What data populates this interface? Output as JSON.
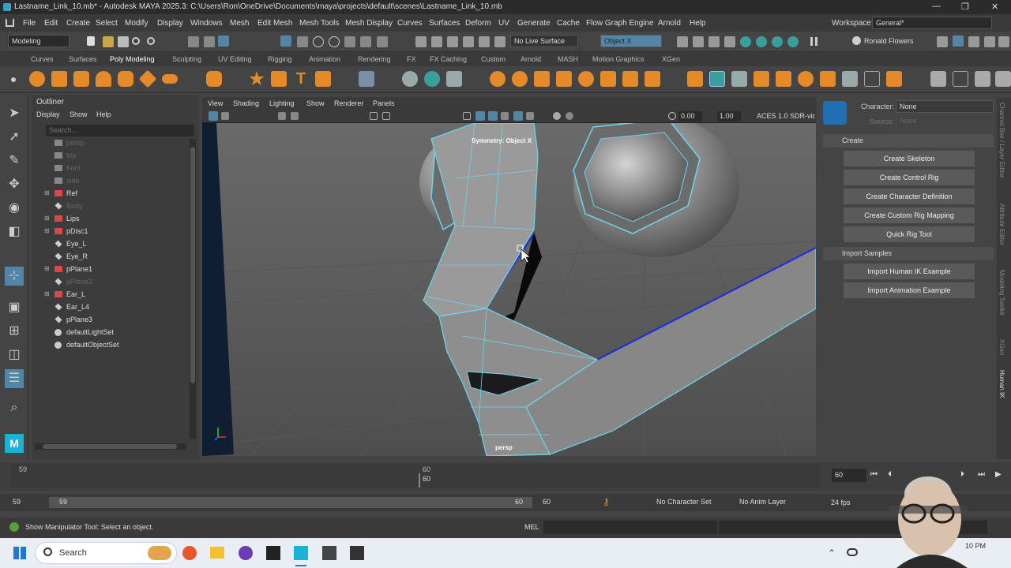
{
  "titlebar": {
    "title": "Lastname_Link_10.mb* - Autodesk MAYA 2025.3: C:\\Users\\Ron\\OneDrive\\Documents\\maya\\projects\\default\\scenes\\Lastname_Link_10.mb",
    "minimize": "—",
    "maximize": "❐",
    "close": "✕"
  },
  "menubar": {
    "items": [
      "File",
      "Edit",
      "Create",
      "Select",
      "Modify",
      "Display",
      "Windows",
      "Mesh",
      "Edit Mesh",
      "Mesh Tools",
      "Mesh Display",
      "Curves",
      "Surfaces",
      "Deform",
      "UV",
      "Generate",
      "Cache",
      "Flow Graph Engine",
      "Arnold",
      "Help"
    ],
    "workspace_label": "Workspace:",
    "workspace_value": "General*"
  },
  "statusline": {
    "mode": "Modeling",
    "live_surface": "No Live Surface",
    "symmetry": "Object X",
    "user": "Ronald Flowers"
  },
  "shelf": {
    "tabs": [
      "Curves",
      "Surfaces",
      "Poly Modeling",
      "Sculpting",
      "UV Editing",
      "Rigging",
      "Animation",
      "Rendering",
      "FX",
      "FX Caching",
      "Custom",
      "Arnold",
      "MASH",
      "Motion Graphics",
      "XGen"
    ],
    "active_tab": "Poly Modeling"
  },
  "outliner": {
    "title": "Outliner",
    "menus": [
      "Display",
      "Show",
      "Help"
    ],
    "search_placeholder": "Search...",
    "items": [
      {
        "label": "persp",
        "dim": true,
        "type": "camera"
      },
      {
        "label": "top",
        "dim": true,
        "type": "camera"
      },
      {
        "label": "front",
        "dim": true,
        "type": "camera"
      },
      {
        "label": "side",
        "dim": true,
        "type": "camera"
      },
      {
        "label": "Ref",
        "dim": false,
        "type": "mesh",
        "expand": true
      },
      {
        "label": "Body",
        "dim": true,
        "type": "transform"
      },
      {
        "label": "Lips",
        "dim": false,
        "type": "mesh",
        "expand": true
      },
      {
        "label": "pDisc1",
        "dim": false,
        "type": "mesh",
        "expand": true
      },
      {
        "label": "Eye_L",
        "dim": false,
        "type": "transform"
      },
      {
        "label": "Eye_R",
        "dim": false,
        "type": "transform"
      },
      {
        "label": "pPlane1",
        "dim": false,
        "type": "mesh",
        "expand": true
      },
      {
        "label": "pPlane2",
        "dim": true,
        "type": "transform"
      },
      {
        "label": "Ear_L",
        "dim": false,
        "type": "mesh",
        "expand": true
      },
      {
        "label": "Ear_L4",
        "dim": false,
        "type": "transform"
      },
      {
        "label": "pPlane3",
        "dim": false,
        "type": "transform"
      },
      {
        "label": "defaultLightSet",
        "dim": false,
        "type": "set"
      },
      {
        "label": "defaultObjectSet",
        "dim": false,
        "type": "set"
      }
    ]
  },
  "viewport": {
    "menus": [
      "View",
      "Shading",
      "Lighting",
      "Show",
      "Renderer",
      "Panels"
    ],
    "field1": "0.00",
    "field2": "1.00",
    "colorspace": "ACES 1.0 SDR-vid",
    "symmetry_label": "Symmetry: Object X",
    "camera_label": "persp"
  },
  "hik": {
    "character_label": "Character:",
    "character_value": "None",
    "source_label": "Source:",
    "source_value": "None",
    "create_section": "Create",
    "create_buttons": [
      "Create Skeleton",
      "Create Control Rig",
      "Create Character Definition",
      "Create Custom Rig Mapping",
      "Quick Rig Tool"
    ],
    "import_section": "Import Samples",
    "import_buttons": [
      "Import Human IK Example",
      "Import Animation Example"
    ]
  },
  "side_tabs": [
    "Channel Box / Layer Editor",
    "Attribute Editor",
    "Modeling Toolkit",
    "XGen",
    "Human IK"
  ],
  "timeline": {
    "start": "59",
    "current": "60",
    "current_marker": "60",
    "end_field": "60"
  },
  "range": {
    "start": "59",
    "inner_start": "59",
    "inner_end": "60",
    "end": "60",
    "character_set": "No Character Set",
    "anim_layer": "No Anim Layer",
    "fps": "24 fps"
  },
  "cmdline": {
    "help_text": "Show Manipulator Tool: Select an object.",
    "lang": "MEL"
  },
  "taskbar": {
    "search": "Search",
    "time": "10 PM"
  },
  "colors": {
    "wire": "#6ad6f0",
    "selected_edge": "#1a2be0",
    "active_tool": "#5285a6"
  }
}
